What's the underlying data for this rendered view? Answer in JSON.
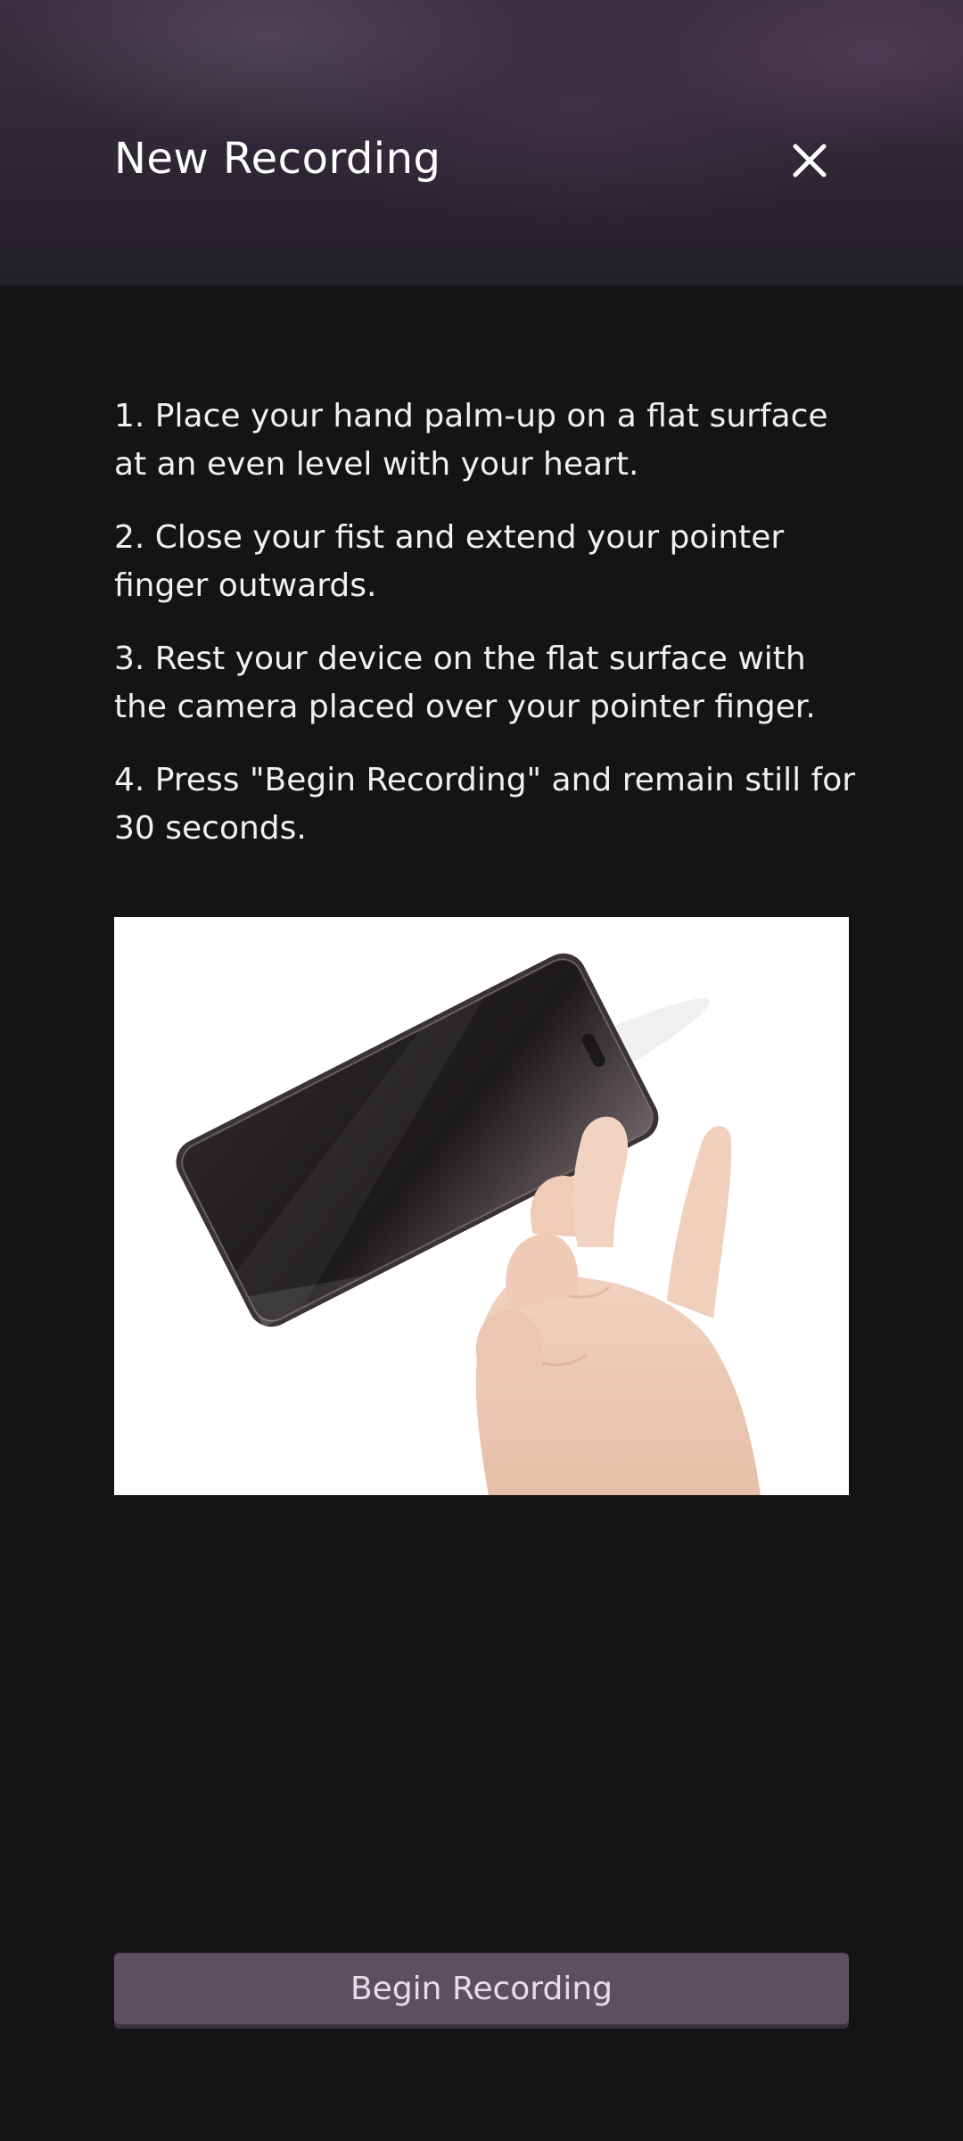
{
  "header": {
    "title": "New Recording",
    "close_icon": "close-icon"
  },
  "instructions": [
    "1. Place your hand palm-up on a flat surface at an even level with your heart.",
    "2. Close your fist and extend your pointer finger outwards.",
    "3. Rest your device on the flat surface with the camera placed over your pointer finger.",
    "4. Press \"Begin Recording\" and remain still for 30 seconds."
  ],
  "illustration": {
    "icon": "phone-on-finger-illustration"
  },
  "actions": {
    "begin_label": "Begin Recording"
  },
  "colors": {
    "background": "#141416",
    "header": "#2e2735",
    "button": "#5e4f5f",
    "text": "#f2f2f2"
  }
}
